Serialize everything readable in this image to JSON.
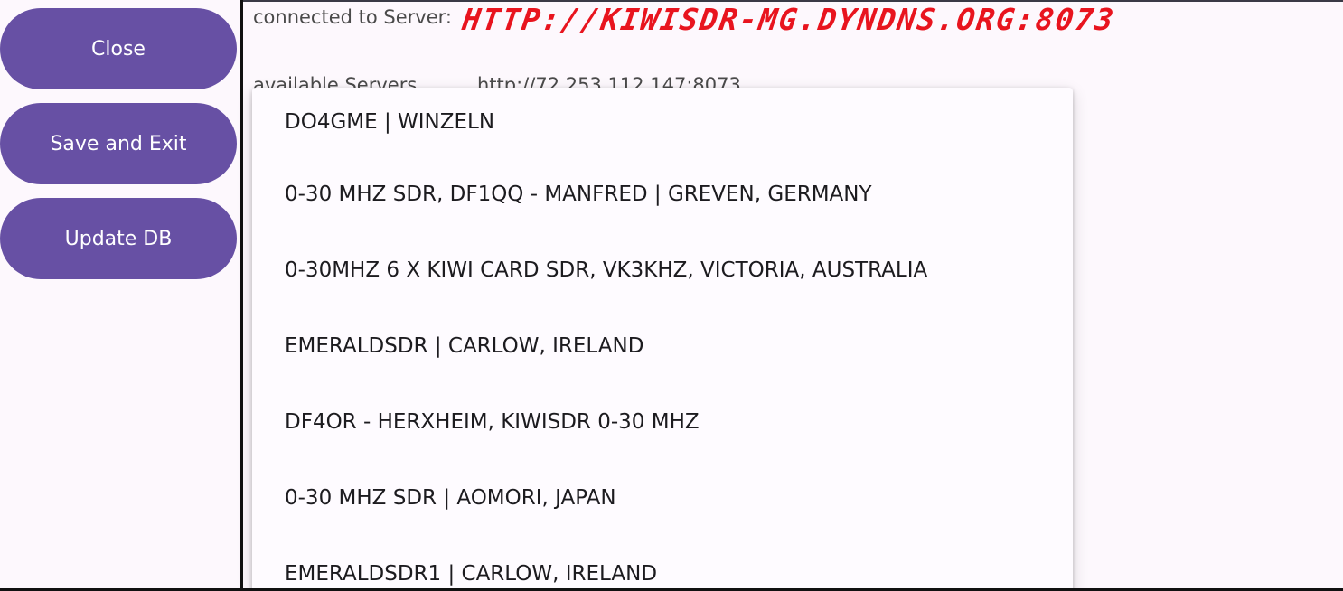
{
  "sidebar": {
    "buttons": [
      {
        "label": "Close"
      },
      {
        "label": "Save and Exit"
      },
      {
        "label": "Update DB"
      }
    ]
  },
  "connection": {
    "label": "connected to Server:",
    "url": "HTTP://KIWISDR-MG.DYNDNS.ORG:8073"
  },
  "servers": {
    "label": "available Servers",
    "selected_value": "http://72.253.112.147:8073",
    "options": [
      "DO4GME | WINZELN",
      "0-30 MHZ SDR, DF1QQ - MANFRED | GREVEN, GERMANY",
      "0-30MHZ 6 X KIWI CARD SDR, VK3KHZ, VICTORIA, AUSTRALIA",
      "EMERALDSDR | CARLOW, IRELAND",
      "DF4OR - HERXHEIM, KIWISDR 0-30 MHZ",
      "0-30 MHZ SDR | AOMORI, JAPAN",
      "EMERALDSDR1 | CARLOW, IRELAND"
    ]
  },
  "colors": {
    "button_bg": "#6750a4",
    "url_color": "#e8141e",
    "background": "#fdf8fd"
  }
}
